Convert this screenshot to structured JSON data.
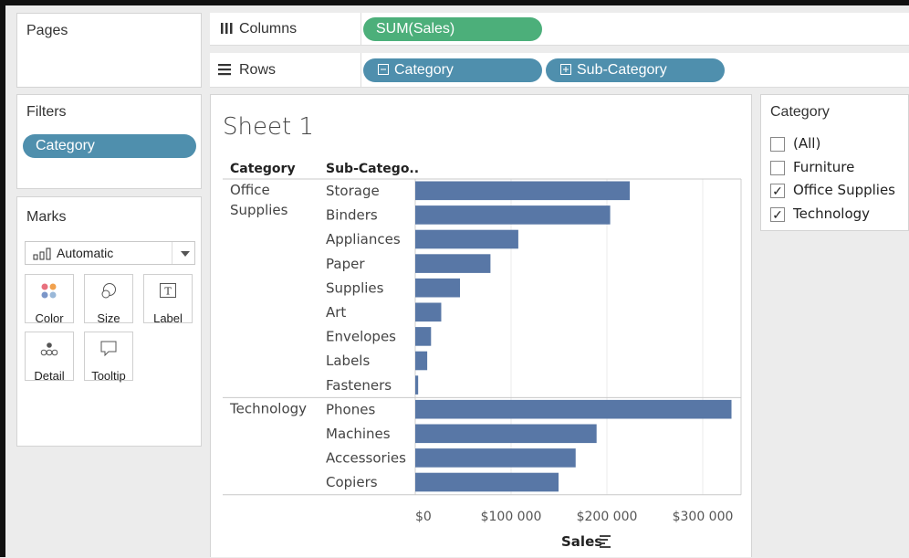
{
  "shelves": {
    "pages_title": "Pages",
    "columns_label": "Columns",
    "rows_label": "Rows",
    "columns_pills": [
      "SUM(Sales)"
    ],
    "rows_pills": [
      "Category",
      "Sub-Category"
    ]
  },
  "filters": {
    "title": "Filters",
    "pills": [
      "Category"
    ]
  },
  "marks": {
    "title": "Marks",
    "mark_type": "Automatic",
    "buttons": [
      "Color",
      "Size",
      "Label",
      "Detail",
      "Tooltip"
    ]
  },
  "legend": {
    "title": "Category",
    "items": [
      {
        "label": "(All)",
        "checked": false
      },
      {
        "label": "Furniture",
        "checked": false
      },
      {
        "label": "Office Supplies",
        "checked": true
      },
      {
        "label": "Technology",
        "checked": true
      }
    ]
  },
  "sheet": {
    "title": "Sheet 1",
    "header_category": "Category",
    "header_subcategory": "Sub-Catego..",
    "axis_label": "Sales"
  },
  "chart_data": {
    "type": "bar",
    "orientation": "horizontal",
    "bar_color": "#5877a6",
    "xlim": [
      0,
      340000
    ],
    "x_ticks": [
      0,
      100000,
      200000,
      300000
    ],
    "x_tick_labels": [
      "$0",
      "$100 000",
      "$200 000",
      "$300 000"
    ],
    "xlabel": "Sales",
    "groups": [
      {
        "category": "Office\nSupplies",
        "items": [
          {
            "name": "Storage",
            "value": 223844
          },
          {
            "name": "Binders",
            "value": 203413
          },
          {
            "name": "Appliances",
            "value": 107532
          },
          {
            "name": "Paper",
            "value": 78479
          },
          {
            "name": "Supplies",
            "value": 46674
          },
          {
            "name": "Art",
            "value": 27119
          },
          {
            "name": "Envelopes",
            "value": 16476
          },
          {
            "name": "Labels",
            "value": 12486
          },
          {
            "name": "Fasteners",
            "value": 3024
          }
        ]
      },
      {
        "category": "Technology",
        "items": [
          {
            "name": "Phones",
            "value": 330007
          },
          {
            "name": "Machines",
            "value": 189239
          },
          {
            "name": "Accessories",
            "value": 167380
          },
          {
            "name": "Copiers",
            "value": 149528
          }
        ]
      }
    ]
  }
}
